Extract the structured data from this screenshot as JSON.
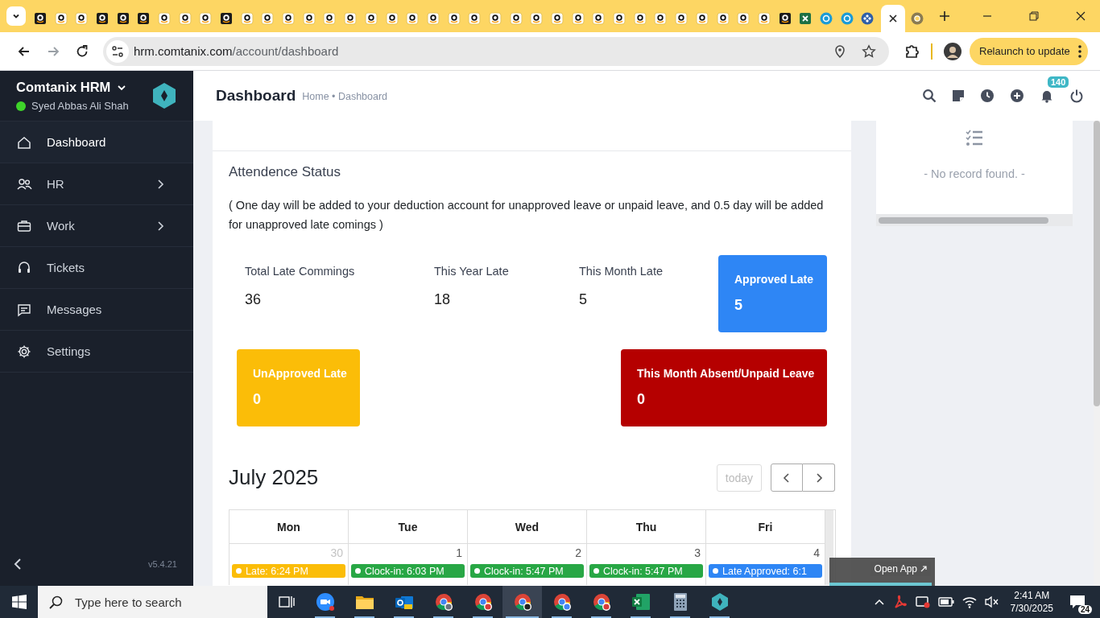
{
  "browser": {
    "tabs": [
      {
        "kind": "dark",
        "selected": false
      },
      {
        "kind": "light",
        "selected": false
      },
      {
        "kind": "light",
        "selected": false
      },
      {
        "kind": "dark",
        "selected": false
      },
      {
        "kind": "dark",
        "selected": false
      },
      {
        "kind": "dark",
        "selected": false
      },
      {
        "kind": "light",
        "selected": false
      },
      {
        "kind": "light",
        "selected": false
      },
      {
        "kind": "light",
        "selected": false
      },
      {
        "kind": "dark",
        "selected": false
      },
      {
        "kind": "light",
        "selected": false
      },
      {
        "kind": "light",
        "selected": false
      },
      {
        "kind": "light",
        "selected": false
      },
      {
        "kind": "light",
        "selected": false
      },
      {
        "kind": "light",
        "selected": false
      },
      {
        "kind": "light",
        "selected": false
      },
      {
        "kind": "light",
        "selected": false
      },
      {
        "kind": "light",
        "selected": false
      },
      {
        "kind": "light",
        "selected": false
      },
      {
        "kind": "light",
        "selected": false
      },
      {
        "kind": "light",
        "selected": false
      },
      {
        "kind": "light",
        "selected": false
      },
      {
        "kind": "light",
        "selected": false
      },
      {
        "kind": "light",
        "selected": false
      },
      {
        "kind": "light",
        "selected": false
      },
      {
        "kind": "light",
        "selected": false
      },
      {
        "kind": "light",
        "selected": false
      },
      {
        "kind": "light",
        "selected": false
      },
      {
        "kind": "light",
        "selected": false
      },
      {
        "kind": "light",
        "selected": false
      },
      {
        "kind": "light",
        "selected": false
      },
      {
        "kind": "light",
        "selected": false
      },
      {
        "kind": "light",
        "selected": false
      },
      {
        "kind": "light",
        "selected": false
      },
      {
        "kind": "light",
        "selected": false
      },
      {
        "kind": "light",
        "selected": false
      },
      {
        "kind": "dark",
        "selected": false
      },
      {
        "kind": "sheet",
        "selected": false
      },
      {
        "kind": "coin",
        "selected": false
      },
      {
        "kind": "coin",
        "selected": false
      },
      {
        "kind": "diamond",
        "selected": false
      },
      {
        "kind": "blank",
        "selected": true
      },
      {
        "kind": "wheel",
        "selected": false
      }
    ],
    "address": {
      "host": "hrm.comtanix.com",
      "path": "/account/dashboard"
    },
    "relaunch": "Relaunch to update"
  },
  "sidebar": {
    "brand": "Comtanix HRM",
    "user": "Syed Abbas Ali Shah",
    "online": true,
    "items": [
      {
        "label": "Dashboard",
        "selected": true,
        "expandable": false
      },
      {
        "label": "HR",
        "selected": false,
        "expandable": true
      },
      {
        "label": "Work",
        "selected": false,
        "expandable": true
      },
      {
        "label": "Tickets",
        "selected": false,
        "expandable": false
      },
      {
        "label": "Messages",
        "selected": false,
        "expandable": false
      },
      {
        "label": "Settings",
        "selected": false,
        "expandable": false
      }
    ],
    "version": "v5.4.21"
  },
  "header": {
    "title": "Dashboard",
    "breadcrumb": "Home • Dashboard",
    "notifications": "140"
  },
  "right_panel": {
    "empty_text": "- No record found. -"
  },
  "attendance": {
    "title": "Attendence Status",
    "note": "( One day will be added to your deduction account for unapproved leave or unpaid leave, and 0.5 day will be added for unapproved late comings )",
    "stat_rows": [
      {
        "items": [
          {
            "kind": "plain",
            "label": "Total Late Commings",
            "value": "36"
          },
          {
            "kind": "plain",
            "label": "This Year Late",
            "value": "18"
          },
          {
            "kind": "plain",
            "label": "This Month Late",
            "value": "5"
          },
          {
            "kind": "box",
            "label": "Approved Late",
            "value": "5",
            "color": "#2e86f5"
          }
        ]
      },
      {
        "items": [
          {
            "kind": "box",
            "label": "UnApproved Late",
            "value": "0",
            "color": "#fbbd08"
          },
          {
            "kind": "box",
            "label": "This Month Absent/Unpaid Leave",
            "value": "0",
            "color": "#b50000"
          }
        ]
      }
    ]
  },
  "calendar": {
    "title": "July 2025",
    "today": "today",
    "today_disabled": true,
    "days": [
      "Mon",
      "Tue",
      "Wed",
      "Thu",
      "Fri"
    ],
    "cells": [
      {
        "date": "30",
        "other_month": true,
        "events": [
          {
            "label": "Late: 6:24 PM",
            "color": "#fbbd08"
          }
        ]
      },
      {
        "date": "1",
        "other_month": false,
        "events": [
          {
            "label": "Clock-in: 6:03 PM",
            "color": "#28a745"
          }
        ]
      },
      {
        "date": "2",
        "other_month": false,
        "events": [
          {
            "label": "Clock-in: 5:47 PM",
            "color": "#28a745"
          }
        ]
      },
      {
        "date": "3",
        "other_month": false,
        "events": [
          {
            "label": "Clock-in: 5:47 PM",
            "color": "#28a745"
          }
        ]
      },
      {
        "date": "4",
        "other_month": false,
        "events": [
          {
            "label": "Late Approved: 6:1",
            "color": "#2e86f5"
          }
        ]
      }
    ]
  },
  "popup": {
    "label": "Open App"
  },
  "taskbar": {
    "search_placeholder": "Type here to search",
    "apps": [
      {
        "selected": false
      },
      {
        "selected": false
      },
      {
        "selected": false
      },
      {
        "selected": false
      },
      {
        "selected": false
      },
      {
        "selected": true
      },
      {
        "selected": false
      },
      {
        "selected": false
      },
      {
        "selected": false
      },
      {
        "selected": false
      },
      {
        "selected": false
      }
    ],
    "time": "2:41 AM",
    "date": "7/30/2025",
    "notifications": "24"
  }
}
